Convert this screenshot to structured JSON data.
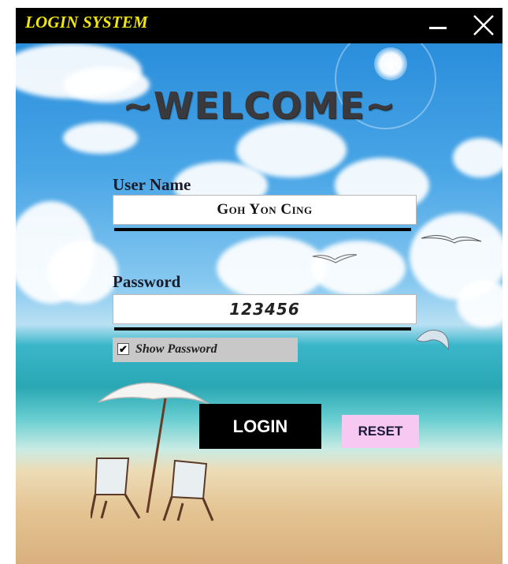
{
  "window": {
    "title": "LOGIN SYSTEM",
    "minimize_icon": "minimize-icon",
    "close_icon": "close-icon"
  },
  "heading": "~WELCOME~",
  "username": {
    "label": "User Name",
    "value": "Goh Yon Cing"
  },
  "password": {
    "label": "Password",
    "value": "123456"
  },
  "show_password": {
    "label": "Show Password",
    "checked": true,
    "check_mark": "✔"
  },
  "buttons": {
    "login": "LOGIN",
    "reset": "RESET"
  },
  "colors": {
    "title": "#f2e60a",
    "reset_bg": "#f7c8f2",
    "login_bg": "#000000"
  }
}
